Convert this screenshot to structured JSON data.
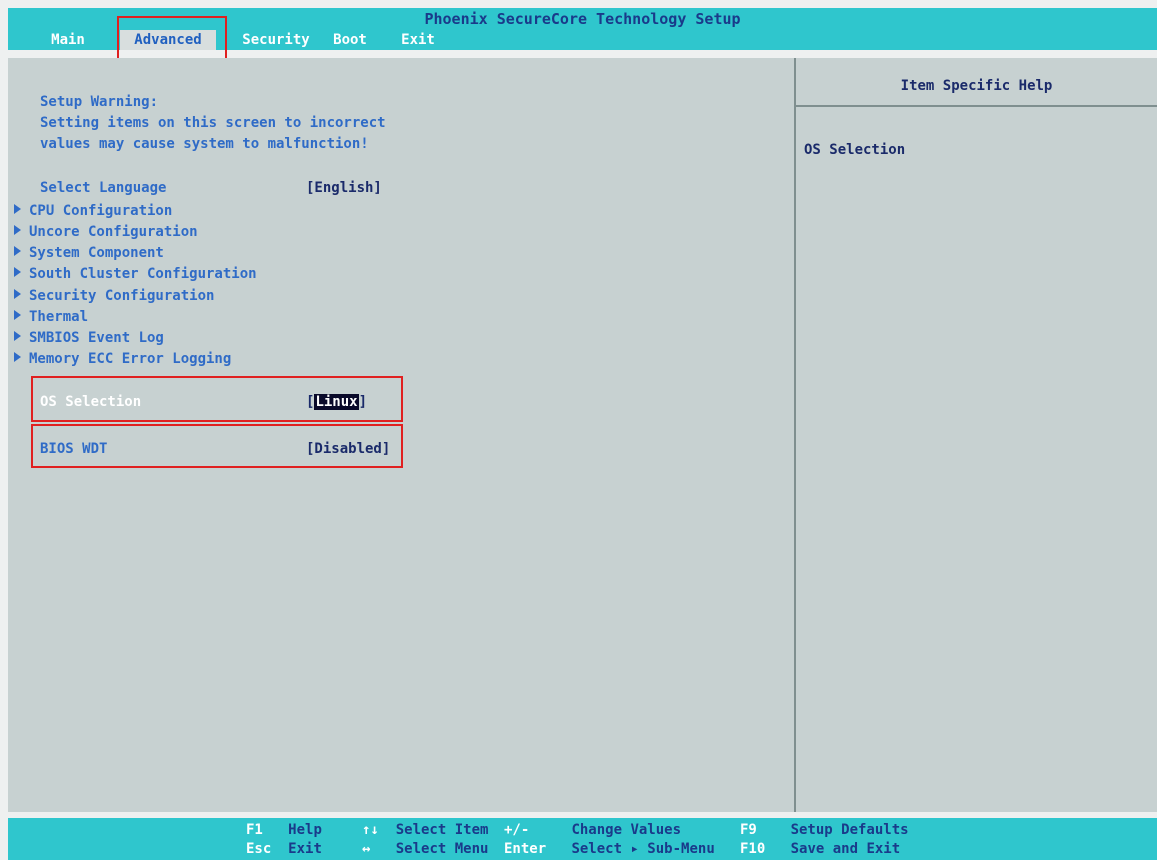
{
  "window": {
    "title": "Phoenix SecureCore Technology Setup"
  },
  "menu": {
    "tabs": [
      {
        "label": "Main"
      },
      {
        "label": "Advanced"
      },
      {
        "label": "Security"
      },
      {
        "label": "Boot"
      },
      {
        "label": "Exit"
      }
    ],
    "active": "Advanced"
  },
  "warning": {
    "line1": "Setup Warning:",
    "line2": "Setting items on this screen to incorrect",
    "line3": "values may cause system to malfunction!"
  },
  "settings": {
    "language": {
      "label": "Select Language",
      "value": "[English]"
    },
    "submenus": [
      "CPU Configuration",
      "Uncore Configuration",
      "System Component",
      "South Cluster Configuration",
      "Security Configuration",
      "Thermal",
      "SMBIOS Event Log",
      "Memory ECC Error Logging"
    ],
    "os_selection": {
      "label": "OS Selection",
      "bracket_open": "[",
      "value": "Linux",
      "bracket_close": "]"
    },
    "bios_wdt": {
      "label": "BIOS WDT",
      "value": "[Disabled]"
    }
  },
  "help": {
    "title": "Item Specific Help",
    "text": "OS Selection"
  },
  "footer": {
    "keys": [
      {
        "key": "F1",
        "desc": "Help"
      },
      {
        "key": "↑↓",
        "desc": "Select Item"
      },
      {
        "key": "+/-",
        "desc": "Change Values"
      },
      {
        "key": "F9",
        "desc": "Setup Defaults"
      },
      {
        "key": "Esc",
        "desc": "Exit"
      },
      {
        "key": "↔",
        "desc": "Select Menu"
      },
      {
        "key": "Enter",
        "desc": "Select ▸ Sub-Menu"
      },
      {
        "key": "F10",
        "desc": "Save and Exit"
      }
    ]
  },
  "colors": {
    "bar": "#2fc6cd",
    "panel": "#c7d1d1",
    "item_text": "#2f6bc7",
    "highlight_box": "#e02020"
  }
}
